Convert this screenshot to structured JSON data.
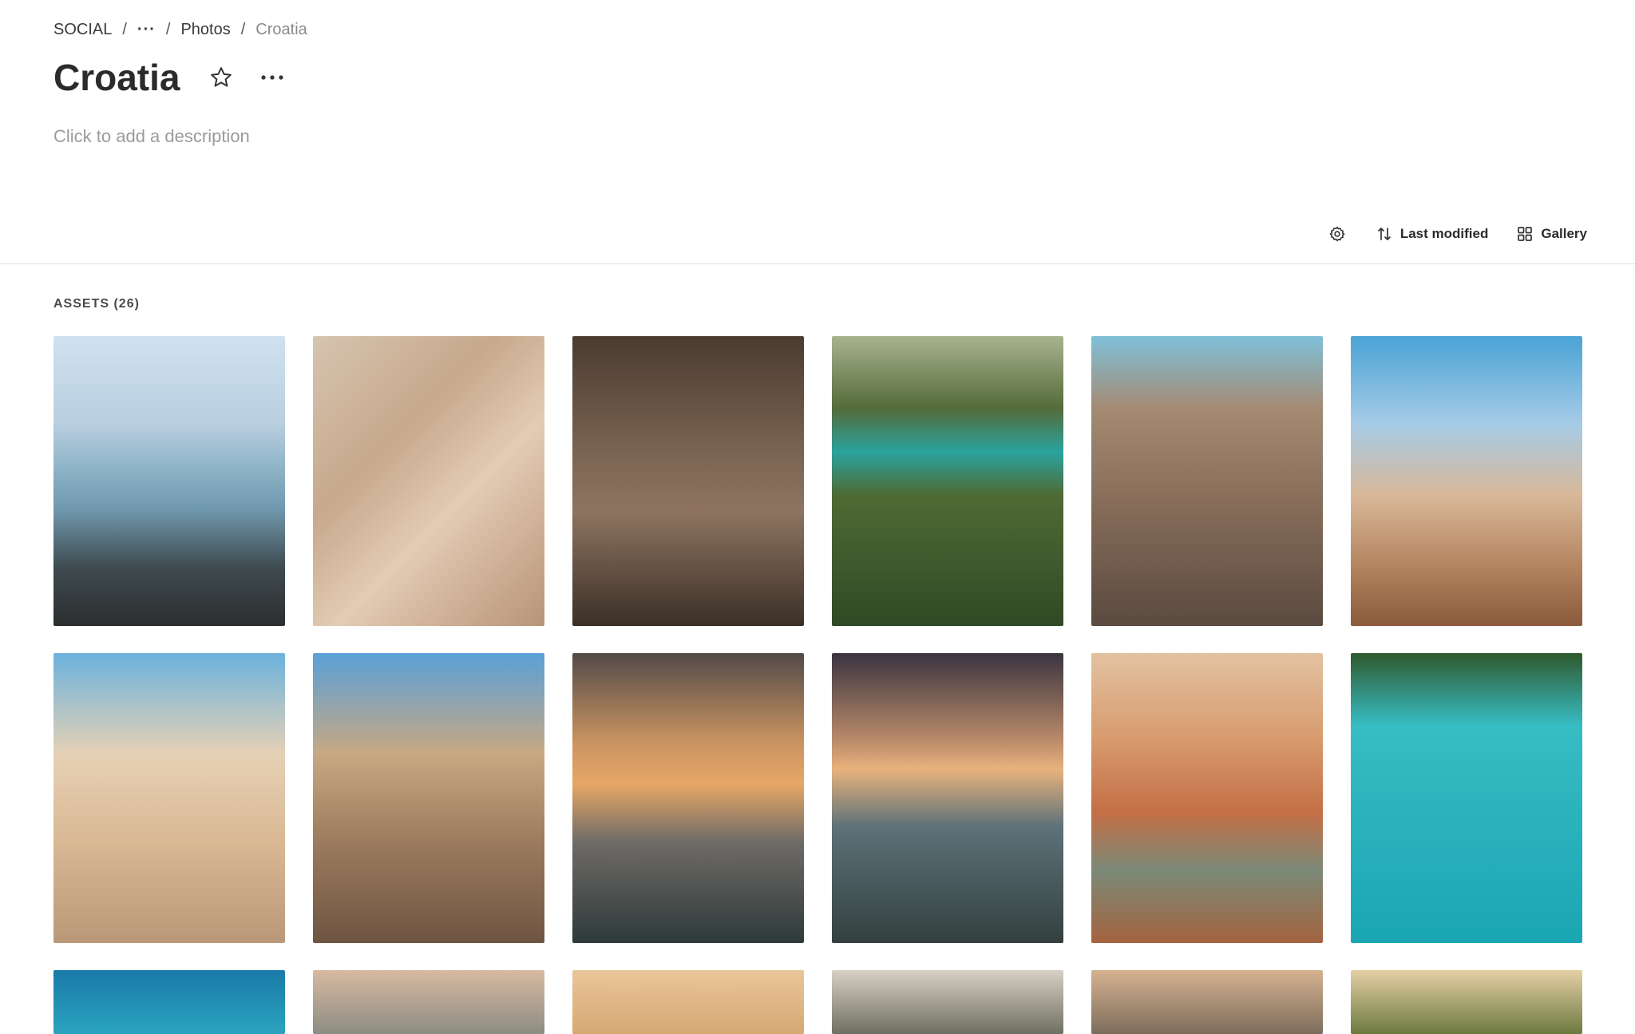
{
  "breadcrumb": {
    "root": "SOCIAL",
    "separator": "/",
    "ellipsis": "···",
    "parent": "Photos",
    "current": "Croatia"
  },
  "page": {
    "title": "Croatia",
    "description_placeholder": "Click to add a description"
  },
  "toolbar": {
    "settings_icon": "gear-icon",
    "sort_icon": "sort-arrows-icon",
    "sort_label": "Last modified",
    "view_icon": "grid-icon",
    "view_label": "Gallery"
  },
  "assets": {
    "heading": "ASSETS (26)",
    "thumbnails": [
      {
        "subject": "waterfront-terrace"
      },
      {
        "subject": "old-town-street-cafe"
      },
      {
        "subject": "stone-alley"
      },
      {
        "subject": "lakes-and-waterfalls"
      },
      {
        "subject": "alley-cafe-chairs"
      },
      {
        "subject": "cathedral-square"
      },
      {
        "subject": "stradun-bell-tower"
      },
      {
        "subject": "narrow-stone-street"
      },
      {
        "subject": "sunset-sea-pool"
      },
      {
        "subject": "sunset-sea-pool-swimmer"
      },
      {
        "subject": "aerial-old-town-harbour"
      },
      {
        "subject": "aerial-beach-spit"
      },
      {
        "subject": "turquoise-sea"
      },
      {
        "subject": "coastal-hills-sunset"
      },
      {
        "subject": "golden-hour-horizon"
      },
      {
        "subject": "mountain-coast"
      },
      {
        "subject": "aerial-coast-town"
      },
      {
        "subject": "hillside-village"
      }
    ]
  },
  "colors": {
    "text_primary": "#2b2b2b",
    "text_muted": "#9b9b9b",
    "divider": "#dcdcdc",
    "background": "#ffffff"
  }
}
